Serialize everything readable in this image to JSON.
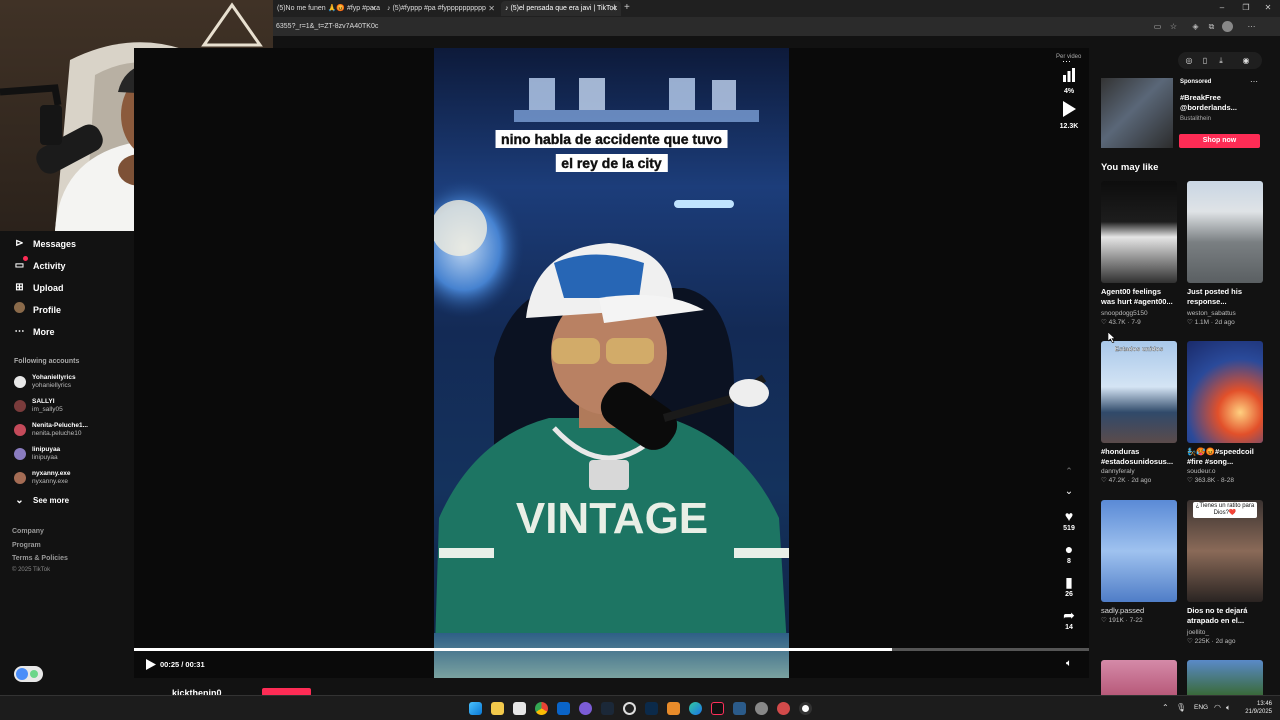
{
  "browser": {
    "tabs": [
      {
        "label": "(5)No me funen 🙏😡 #fyp #para",
        "active": false
      },
      {
        "label": "(5)#fyppp #pa #fypppppppppp",
        "active": false
      },
      {
        "label": "(5)el pensada que era javi | TikTok",
        "active": true
      }
    ],
    "new_tab": "+",
    "url": "6355?_r=1&_t=ZT-8zv7A40TK0c",
    "window_controls": [
      "–",
      "❐",
      "✕"
    ]
  },
  "sidebar": {
    "nav": [
      {
        "label": "Messages",
        "icon": "paper-plane-icon"
      },
      {
        "label": "Activity",
        "icon": "inbox-icon"
      },
      {
        "label": "Upload",
        "icon": "plus-square-icon"
      },
      {
        "label": "Profile",
        "icon": "avatar-icon"
      },
      {
        "label": "More",
        "icon": "more-dots-icon"
      }
    ],
    "following_title": "Following accounts",
    "accounts": [
      {
        "name": "Yohaniellyrics",
        "handle": "yohaniellyrics",
        "color": "#e8e8e8"
      },
      {
        "name": "SALLYI",
        "handle": "im_sally05",
        "color": "#7a3b3b"
      },
      {
        "name": "Nenita-Peluche1...",
        "handle": "nenita.peluche10",
        "color": "#c44a5a"
      },
      {
        "name": "linipuyaa",
        "handle": "linipuyaa",
        "color": "#8a7cc0"
      },
      {
        "name": "nyxanny.exe",
        "handle": "nyxanny.exe",
        "color": "#a46c54"
      }
    ],
    "see_more": "See more",
    "footer_links": [
      "Company",
      "Program",
      "Terms & Policies"
    ],
    "copyright": "© 2025 TikTok"
  },
  "video": {
    "caption_line1": "nino habla de accidente que tuvo",
    "caption_line2": "el rey de la city",
    "shirt_text": "VINTAGE",
    "time": "00:25 / 00:31",
    "progress": 0.794,
    "author": "kickthenin0",
    "per_label": "Per video"
  },
  "actions": {
    "stats_percent": "4%",
    "plays": "12.3K",
    "likes": "519",
    "comments": "8",
    "saves": "26",
    "shares": "14"
  },
  "right_panel": {
    "ad": {
      "label": "Sponsored",
      "title": "#BreakFree @borderlands...",
      "account": "Bustalithein",
      "cta": "Shop now"
    },
    "you_may_like": "You may like",
    "cards": [
      {
        "title": "Agent00 feelings was hurt #agent00...",
        "user": "snoopdogg5150",
        "stats": "♡ 43.7K · 7-9"
      },
      {
        "title": "Just posted his response...",
        "user": "weston_sabattus",
        "stats": "♡ 1.1M · 2d ago"
      },
      {
        "title": "#honduras #estadosunidosus...",
        "user": "dannyferaly",
        "stats": "♡ 47.2K · 2d ago",
        "overlay": "Estados unidos"
      },
      {
        "title": "🧞🥵😡#speedcoil #fire #song...",
        "user": "soudeur.o",
        "stats": "♡ 363.8K · 8-28"
      },
      {
        "title": "sadly.passed",
        "user": "",
        "stats": "♡ 191K · 7-22"
      },
      {
        "title": "Dios no te dejará atrapado en el...",
        "user": "joellito_",
        "stats": "♡ 225K · 2d ago",
        "overlay": "¿Tienes un ratito para Dios?❤️"
      }
    ]
  },
  "taskbar": {
    "lang": "ENG",
    "time": "13:46",
    "date": "21/9/2025"
  }
}
